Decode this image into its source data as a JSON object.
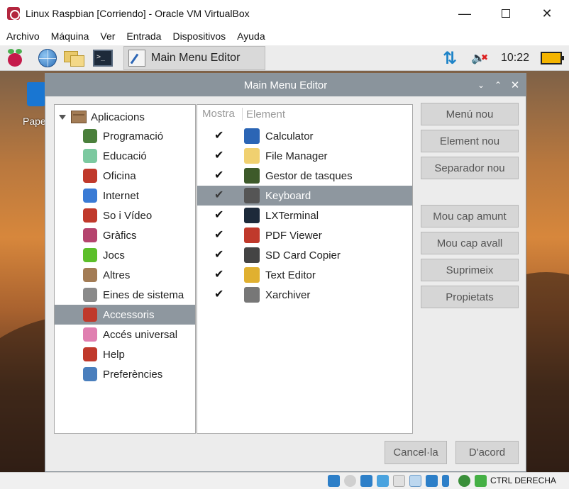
{
  "host": {
    "title": "Linux Raspbian [Corriendo] - Oracle VM VirtualBox",
    "menu": [
      "Archivo",
      "Máquina",
      "Ver",
      "Entrada",
      "Dispositivos",
      "Ayuda"
    ],
    "host_key": "CTRL DERECHA"
  },
  "panel": {
    "task_label": "Main Menu Editor",
    "time": "10:22"
  },
  "desktop": {
    "trash_label": "Pape"
  },
  "dialog": {
    "title": "Main Menu Editor",
    "tree_root": "Aplicacions",
    "tree_items": [
      {
        "label": "Programació",
        "icon": "programming-icon",
        "color": "#4a7f3b"
      },
      {
        "label": "Educació",
        "icon": "education-icon",
        "color": "#7cc9a0"
      },
      {
        "label": "Oficina",
        "icon": "office-icon",
        "color": "#c0392b"
      },
      {
        "label": "Internet",
        "icon": "internet-icon",
        "color": "#3a7bd5"
      },
      {
        "label": "So i Vídeo",
        "icon": "sound-video-icon",
        "color": "#c0392b"
      },
      {
        "label": "Gràfics",
        "icon": "graphics-icon",
        "color": "#b5446e"
      },
      {
        "label": "Jocs",
        "icon": "games-icon",
        "color": "#5cbf2a"
      },
      {
        "label": "Altres",
        "icon": "other-icon",
        "color": "#a37c55"
      },
      {
        "label": "Eines de sistema",
        "icon": "system-tools-icon",
        "color": "#8a8a8a"
      },
      {
        "label": "Accessoris",
        "icon": "accessories-icon",
        "color": "#c0392b"
      },
      {
        "label": "Accés universal",
        "icon": "universal-access-icon",
        "color": "#e07fb0"
      },
      {
        "label": "Help",
        "icon": "help-icon",
        "color": "#c0392b"
      },
      {
        "label": "Preferències",
        "icon": "preferences-icon",
        "color": "#4a7fbd"
      }
    ],
    "selected_tree_index": 9,
    "list_headers": {
      "show": "Mostra",
      "element": "Element"
    },
    "list_items": [
      {
        "label": "Calculator",
        "icon": "calculator-icon",
        "color": "#2b65b5"
      },
      {
        "label": "File Manager",
        "icon": "file-manager-icon",
        "color": "#f0d070"
      },
      {
        "label": "Gestor de tasques",
        "icon": "task-manager-icon",
        "color": "#3d5a2a"
      },
      {
        "label": "Keyboard",
        "icon": "keyboard-icon",
        "color": "#555555"
      },
      {
        "label": "LXTerminal",
        "icon": "terminal-icon",
        "color": "#1d2a3a"
      },
      {
        "label": "PDF Viewer",
        "icon": "pdf-viewer-icon",
        "color": "#c0392b"
      },
      {
        "label": "SD Card Copier",
        "icon": "sd-card-icon",
        "color": "#444444"
      },
      {
        "label": "Text Editor",
        "icon": "text-editor-icon",
        "color": "#e0b030"
      },
      {
        "label": "Xarchiver",
        "icon": "archiver-icon",
        "color": "#777777"
      }
    ],
    "selected_list_index": 3,
    "buttons": {
      "new_menu": "Menú nou",
      "new_item": "Element nou",
      "new_separator": "Separador nou",
      "move_up": "Mou cap amunt",
      "move_down": "Mou cap avall",
      "delete": "Suprimeix",
      "properties": "Propietats",
      "cancel": "Cancel·la",
      "ok": "D'acord"
    }
  }
}
